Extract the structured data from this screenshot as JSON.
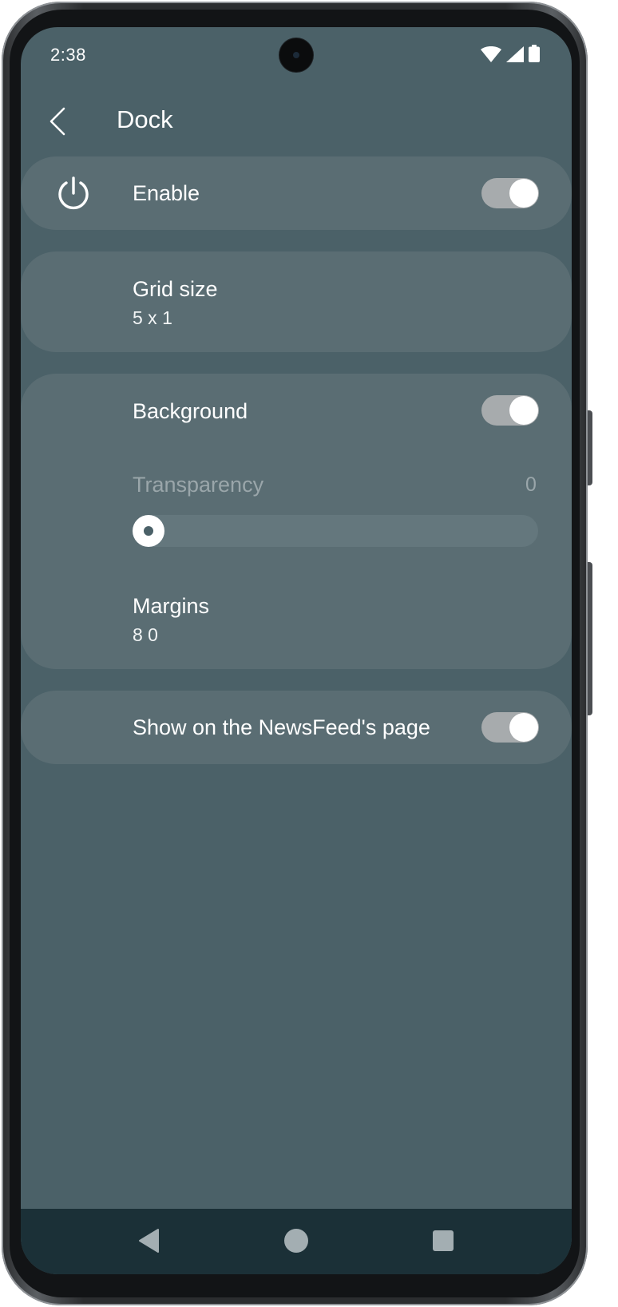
{
  "status_bar": {
    "time": "2:38",
    "icons": [
      "wifi-icon",
      "cellular-signal-icon",
      "battery-icon"
    ]
  },
  "app_bar": {
    "title": "Dock",
    "back_icon": "chevron-left-icon"
  },
  "settings": {
    "enable": {
      "label": "Enable",
      "icon": "power-icon",
      "on": true
    },
    "grid_size": {
      "label": "Grid size",
      "value": "5 x 1"
    },
    "background": {
      "label": "Background",
      "on": true
    },
    "transparency": {
      "label": "Transparency",
      "value": "0",
      "fraction": 0
    },
    "margins": {
      "label": "Margins",
      "value": "8 0"
    },
    "show_newsfeed": {
      "label": "Show on the NewsFeed's page",
      "on": true
    }
  },
  "navigation": {
    "buttons": [
      "back-triangle-icon",
      "home-circle-icon",
      "recents-square-icon"
    ]
  },
  "colors": {
    "screen_bg": "#4b6168",
    "card_bg": "#5a6d73",
    "toggle_track": "#a7abad",
    "nav_bar_bg": "#1b3037",
    "disabled_text": "#9aa6aa"
  }
}
